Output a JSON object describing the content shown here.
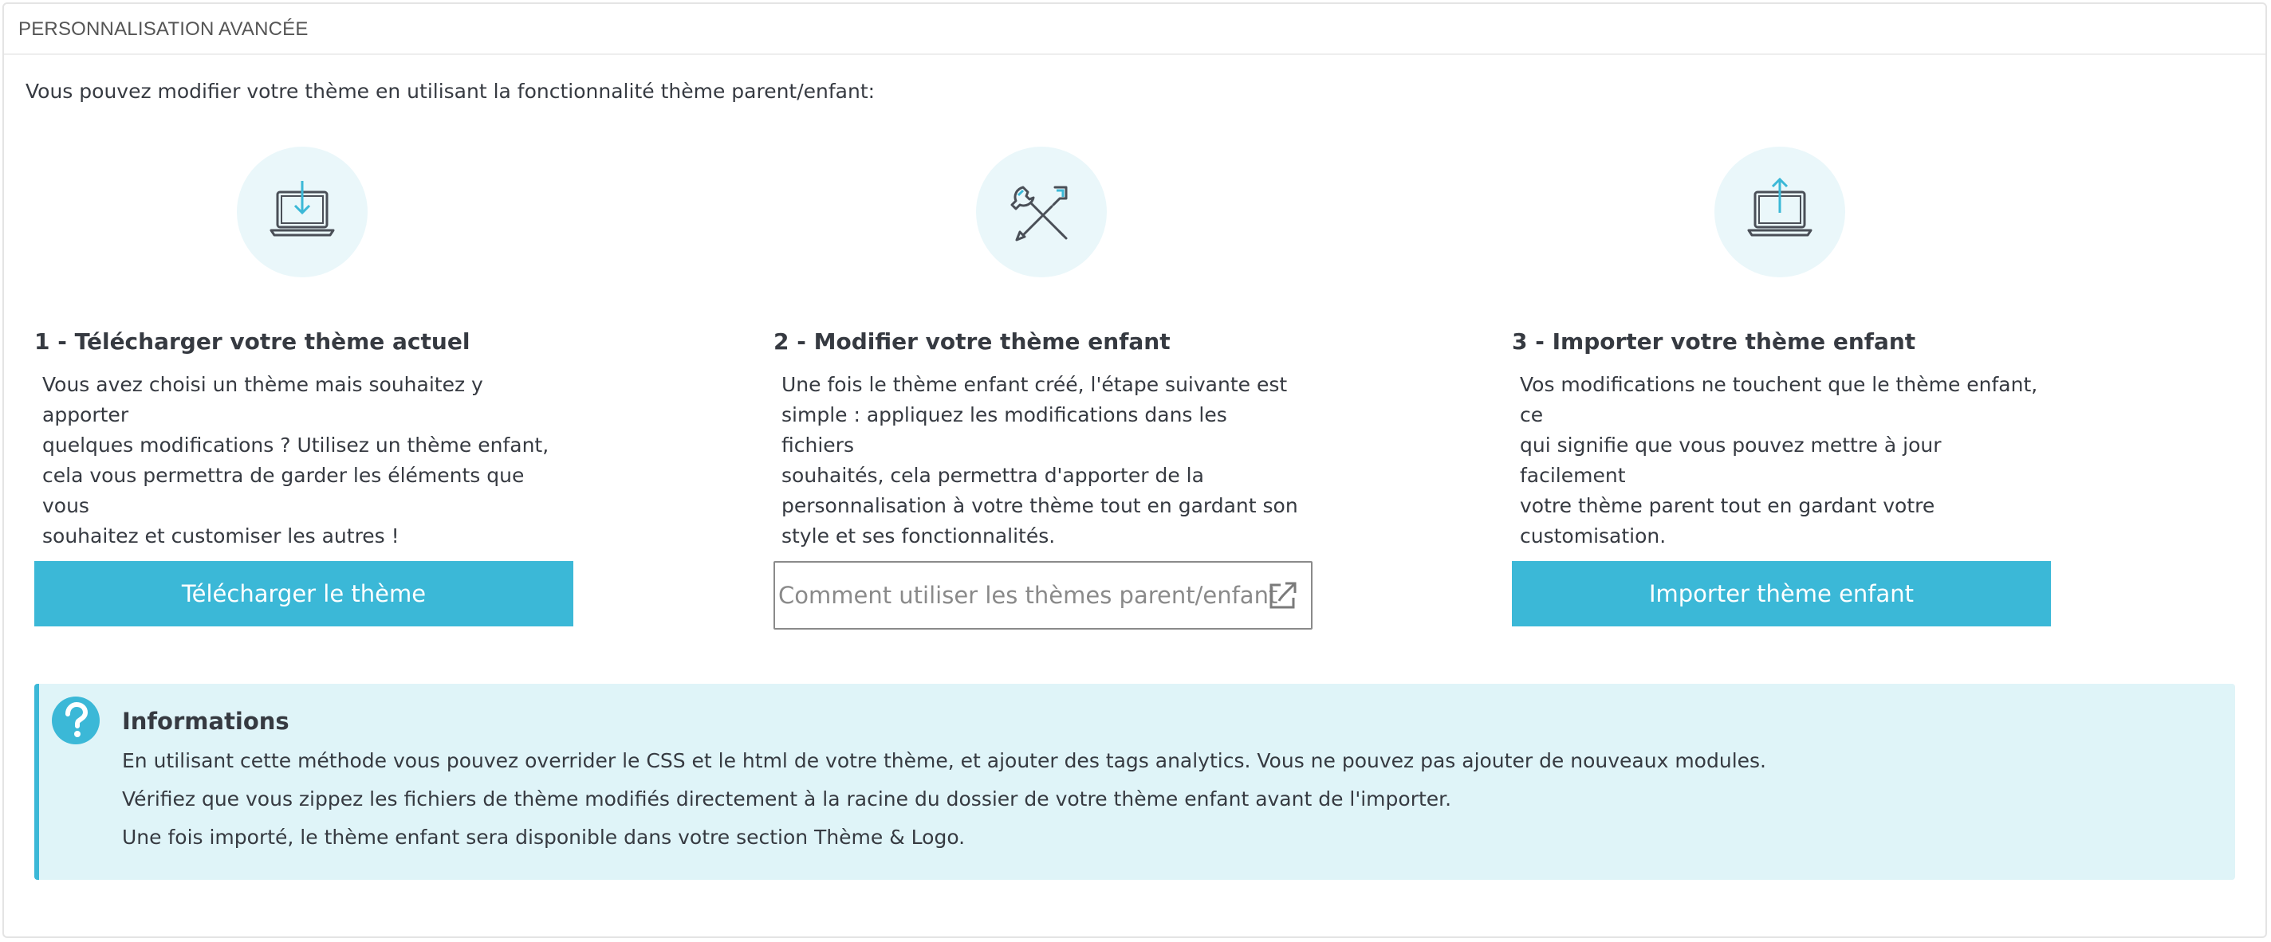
{
  "panel": {
    "title": "PERSONNALISATION AVANCÉE"
  },
  "intro": "Vous pouvez modifier votre thème en utilisant la fonctionnalité thème parent/enfant:",
  "steps": [
    {
      "icon": "laptop-download-icon",
      "title": "1 - Télécharger votre thème actuel",
      "lines": [
        "Vous avez choisi un thème mais souhaitez y apporter",
        "quelques modifications ? Utilisez un thème enfant,",
        "cela vous permettra de garder les éléments que vous",
        "souhaitez et customiser les autres !"
      ],
      "button": "Télécharger le thème"
    },
    {
      "icon": "tools-icon",
      "title": "2 - Modifier votre thème enfant",
      "lines": [
        "Une fois le thème enfant créé, l'étape suivante est",
        "simple : appliquez les modifications dans les fichiers",
        "souhaités, cela permettra d'apporter de la",
        "personnalisation à votre thème tout en gardant son",
        "style et ses fonctionnalités."
      ],
      "button": "Comment utiliser les thèmes parent/enfant"
    },
    {
      "icon": "laptop-upload-icon",
      "title": "3 - Importer votre thème enfant",
      "lines": [
        "Vos modifications ne touchent que le thème enfant, ce",
        "qui signifie que vous pouvez mettre à jour facilement",
        "votre thème parent tout en gardant votre",
        "customisation."
      ],
      "button": "Importer thème enfant"
    }
  ],
  "info": {
    "icon": "question-circle-icon",
    "title": "Informations",
    "lines": [
      "En utilisant cette méthode vous pouvez overrider le CSS et le html de votre thème, et ajouter des tags analytics. Vous ne pouvez pas ajouter de nouveaux modules.",
      "Vérifiez que vous zippez les fichiers de thème modifiés directement à la racine du dossier de votre thème enfant avant de l'importer.",
      "Une fois importé, le thème enfant sera disponible dans votre section Thème & Logo."
    ]
  },
  "colors": {
    "primary": "#3bb8d7",
    "icon_bg": "#eaf7fa",
    "info_bg": "#dff4f8",
    "text": "#363a41"
  }
}
